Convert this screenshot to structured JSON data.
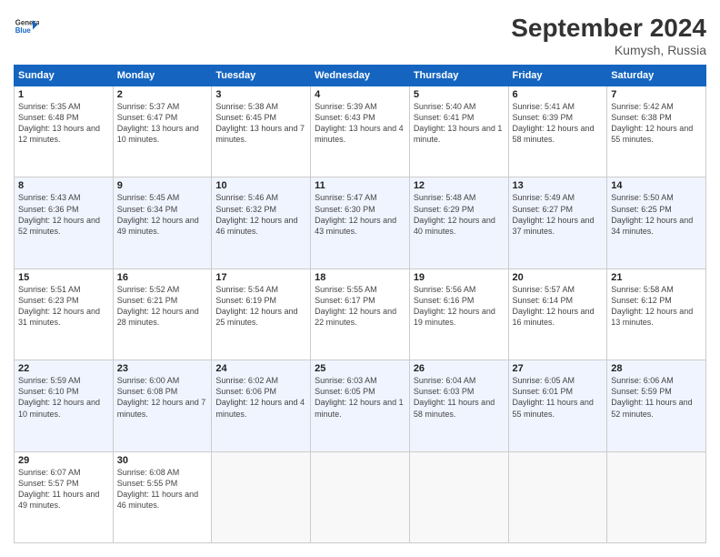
{
  "header": {
    "logo_line1": "General",
    "logo_line2": "Blue",
    "month": "September 2024",
    "location": "Kumysh, Russia"
  },
  "days_of_week": [
    "Sunday",
    "Monday",
    "Tuesday",
    "Wednesday",
    "Thursday",
    "Friday",
    "Saturday"
  ],
  "weeks": [
    [
      {
        "day": "1",
        "sunrise": "5:35 AM",
        "sunset": "6:48 PM",
        "daylight": "13 hours and 12 minutes."
      },
      {
        "day": "2",
        "sunrise": "5:37 AM",
        "sunset": "6:47 PM",
        "daylight": "13 hours and 10 minutes."
      },
      {
        "day": "3",
        "sunrise": "5:38 AM",
        "sunset": "6:45 PM",
        "daylight": "13 hours and 7 minutes."
      },
      {
        "day": "4",
        "sunrise": "5:39 AM",
        "sunset": "6:43 PM",
        "daylight": "13 hours and 4 minutes."
      },
      {
        "day": "5",
        "sunrise": "5:40 AM",
        "sunset": "6:41 PM",
        "daylight": "13 hours and 1 minute."
      },
      {
        "day": "6",
        "sunrise": "5:41 AM",
        "sunset": "6:39 PM",
        "daylight": "12 hours and 58 minutes."
      },
      {
        "day": "7",
        "sunrise": "5:42 AM",
        "sunset": "6:38 PM",
        "daylight": "12 hours and 55 minutes."
      }
    ],
    [
      {
        "day": "8",
        "sunrise": "5:43 AM",
        "sunset": "6:36 PM",
        "daylight": "12 hours and 52 minutes."
      },
      {
        "day": "9",
        "sunrise": "5:45 AM",
        "sunset": "6:34 PM",
        "daylight": "12 hours and 49 minutes."
      },
      {
        "day": "10",
        "sunrise": "5:46 AM",
        "sunset": "6:32 PM",
        "daylight": "12 hours and 46 minutes."
      },
      {
        "day": "11",
        "sunrise": "5:47 AM",
        "sunset": "6:30 PM",
        "daylight": "12 hours and 43 minutes."
      },
      {
        "day": "12",
        "sunrise": "5:48 AM",
        "sunset": "6:29 PM",
        "daylight": "12 hours and 40 minutes."
      },
      {
        "day": "13",
        "sunrise": "5:49 AM",
        "sunset": "6:27 PM",
        "daylight": "12 hours and 37 minutes."
      },
      {
        "day": "14",
        "sunrise": "5:50 AM",
        "sunset": "6:25 PM",
        "daylight": "12 hours and 34 minutes."
      }
    ],
    [
      {
        "day": "15",
        "sunrise": "5:51 AM",
        "sunset": "6:23 PM",
        "daylight": "12 hours and 31 minutes."
      },
      {
        "day": "16",
        "sunrise": "5:52 AM",
        "sunset": "6:21 PM",
        "daylight": "12 hours and 28 minutes."
      },
      {
        "day": "17",
        "sunrise": "5:54 AM",
        "sunset": "6:19 PM",
        "daylight": "12 hours and 25 minutes."
      },
      {
        "day": "18",
        "sunrise": "5:55 AM",
        "sunset": "6:17 PM",
        "daylight": "12 hours and 22 minutes."
      },
      {
        "day": "19",
        "sunrise": "5:56 AM",
        "sunset": "6:16 PM",
        "daylight": "12 hours and 19 minutes."
      },
      {
        "day": "20",
        "sunrise": "5:57 AM",
        "sunset": "6:14 PM",
        "daylight": "12 hours and 16 minutes."
      },
      {
        "day": "21",
        "sunrise": "5:58 AM",
        "sunset": "6:12 PM",
        "daylight": "12 hours and 13 minutes."
      }
    ],
    [
      {
        "day": "22",
        "sunrise": "5:59 AM",
        "sunset": "6:10 PM",
        "daylight": "12 hours and 10 minutes."
      },
      {
        "day": "23",
        "sunrise": "6:00 AM",
        "sunset": "6:08 PM",
        "daylight": "12 hours and 7 minutes."
      },
      {
        "day": "24",
        "sunrise": "6:02 AM",
        "sunset": "6:06 PM",
        "daylight": "12 hours and 4 minutes."
      },
      {
        "day": "25",
        "sunrise": "6:03 AM",
        "sunset": "6:05 PM",
        "daylight": "12 hours and 1 minute."
      },
      {
        "day": "26",
        "sunrise": "6:04 AM",
        "sunset": "6:03 PM",
        "daylight": "11 hours and 58 minutes."
      },
      {
        "day": "27",
        "sunrise": "6:05 AM",
        "sunset": "6:01 PM",
        "daylight": "11 hours and 55 minutes."
      },
      {
        "day": "28",
        "sunrise": "6:06 AM",
        "sunset": "5:59 PM",
        "daylight": "11 hours and 52 minutes."
      }
    ],
    [
      {
        "day": "29",
        "sunrise": "6:07 AM",
        "sunset": "5:57 PM",
        "daylight": "11 hours and 49 minutes."
      },
      {
        "day": "30",
        "sunrise": "6:08 AM",
        "sunset": "5:55 PM",
        "daylight": "11 hours and 46 minutes."
      },
      null,
      null,
      null,
      null,
      null
    ]
  ]
}
